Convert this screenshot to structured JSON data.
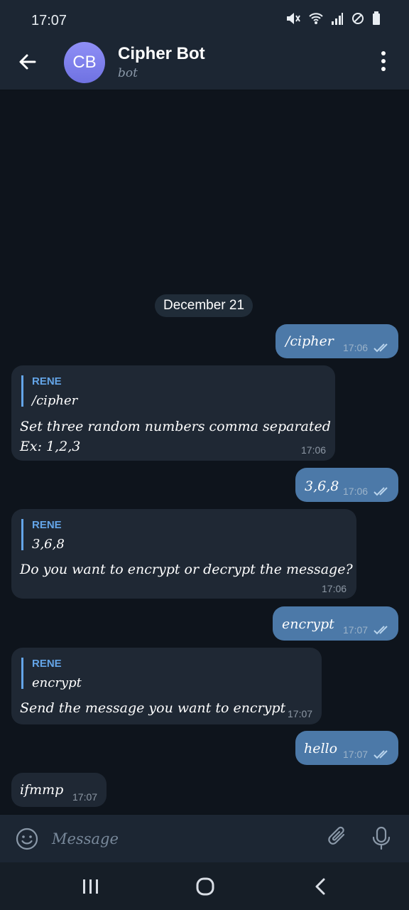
{
  "status": {
    "time": "17:07"
  },
  "header": {
    "title": "Cipher Bot",
    "subtitle": "bot",
    "avatar_initials": "CB"
  },
  "chat": {
    "date": "December 21",
    "messages": [
      {
        "text": "/cipher",
        "time": "17:06",
        "read": true
      },
      {
        "reply_name": "RENE",
        "reply_text": "/cipher",
        "text": "Set three random numbers comma separated\nEx: 1,2,3",
        "time": "17:06"
      },
      {
        "text": "3,6,8",
        "time": "17:06",
        "read": true
      },
      {
        "reply_name": "RENE",
        "reply_text": "3,6,8",
        "text": "Do you want to encrypt or decrypt the message?",
        "time": "17:06"
      },
      {
        "text": "encrypt",
        "time": "17:07",
        "read": true
      },
      {
        "reply_name": "RENE",
        "reply_text": "encrypt",
        "text": "Send the message you want to encrypt",
        "time": "17:07"
      },
      {
        "text": "hello",
        "time": "17:07",
        "read": true
      },
      {
        "text": "ifmmp",
        "time": "17:07"
      }
    ]
  },
  "input": {
    "placeholder": "Message"
  }
}
